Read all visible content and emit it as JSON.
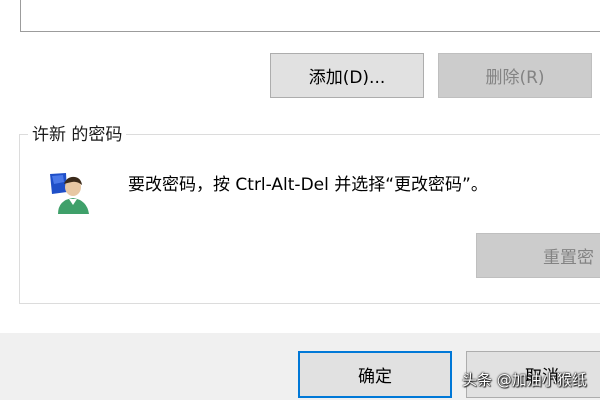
{
  "buttons": {
    "add": "添加(D)...",
    "remove": "删除(R)",
    "reset_password": "重置密",
    "ok": "确定",
    "cancel": "取消"
  },
  "password_section": {
    "title": "许新 的密码",
    "instruction": "要改密码，按 Ctrl-Alt-Del 并选择“更改密码”。",
    "icon": "user-key-icon"
  },
  "watermark": "头条 @加油小猴纸",
  "colors": {
    "focus_border": "#0078d7",
    "button_bg": "#e1e1e1",
    "disabled_bg": "#cccccc",
    "disabled_text": "#838383"
  }
}
